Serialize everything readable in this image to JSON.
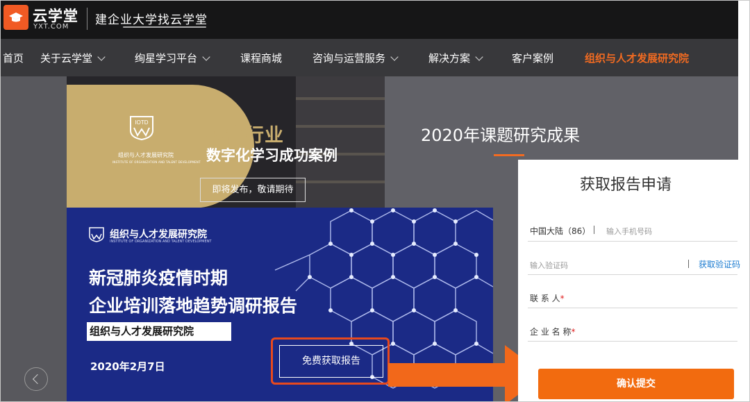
{
  "brand": {
    "name": "云学堂",
    "domain": "YXT.COM",
    "slogan": "建企业大学找云学堂"
  },
  "nav": {
    "items": [
      {
        "label": "首页"
      },
      {
        "label": "关于云学堂"
      },
      {
        "label": "绚星学习平台"
      },
      {
        "label": "课程商城"
      },
      {
        "label": "咨询与运营服务"
      },
      {
        "label": "解决方案"
      },
      {
        "label": "客户案例"
      },
      {
        "label": "组织与人才发展研究院"
      }
    ],
    "active": "组织与人才发展研究院"
  },
  "banner_retail": {
    "emblem_text": "IOTD",
    "emblem_label": "组织与人才发展研究院",
    "emblem_sub": "INSTITUTE OF ORGANIZATION AND TALENT DEVELOPMENT",
    "title": "零售行业",
    "subtitle": "数字化学习成功案例",
    "button": "即将发布，敬请期待"
  },
  "research": {
    "title": "2020年课题研究成果"
  },
  "banner_covid": {
    "org": "组织与人才发展研究院",
    "org_sub": "INSTITUTE OF ORGANIZATION AND TALENT DEVELOPMENT",
    "title_line1": "新冠肺炎疫情时期",
    "title_line2": "企业培训落地趋势调研报告",
    "badge": "组织与人才发展研究院",
    "date": "2020年2月7日",
    "button": "免费获取报告"
  },
  "form": {
    "title": "获取报告申请",
    "region": "中国大陆（86）",
    "phone_placeholder": "输入手机号码",
    "code_placeholder": "输入验证码",
    "get_code": "获取验证码",
    "contact_label": "联 系 人",
    "company_label": "企 业 名 称",
    "required_mark": "*",
    "submit": "确认提交"
  },
  "colors": {
    "accent": "#f26b21",
    "link": "#1a7bd0",
    "banner_blue": "#1b2a86",
    "gold": "#c8ad6e"
  }
}
